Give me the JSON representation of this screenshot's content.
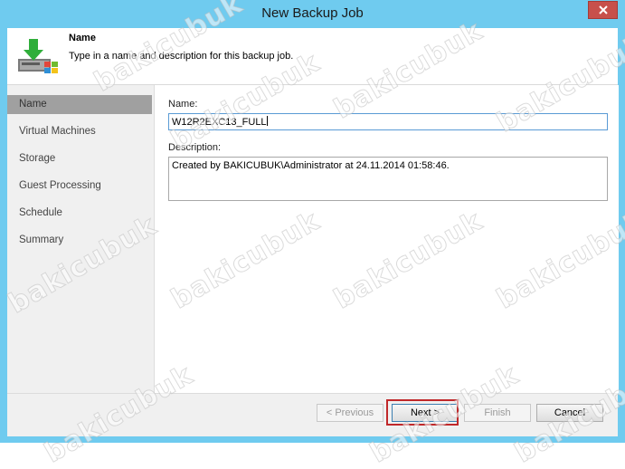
{
  "window": {
    "title": "New Backup Job",
    "close_icon": "close-icon",
    "accent": "#6fcbef"
  },
  "header": {
    "title": "Name",
    "description": "Type in a name and description for this backup job.",
    "icon": "backup-download-icon"
  },
  "steps": [
    {
      "label": "Name",
      "active": true
    },
    {
      "label": "Virtual Machines",
      "active": false
    },
    {
      "label": "Storage",
      "active": false
    },
    {
      "label": "Guest Processing",
      "active": false
    },
    {
      "label": "Schedule",
      "active": false
    },
    {
      "label": "Summary",
      "active": false
    }
  ],
  "form": {
    "name_label": "Name:",
    "name_value": "W12R2EXC13_FULL",
    "description_label": "Description:",
    "description_value": "Created by BAKICUBUK\\Administrator at 24.11.2014 01:58:46."
  },
  "buttons": {
    "previous": "< Previous",
    "next": "Next >",
    "finish": "Finish",
    "cancel": "Cancel"
  },
  "watermark": "bakicubuk"
}
